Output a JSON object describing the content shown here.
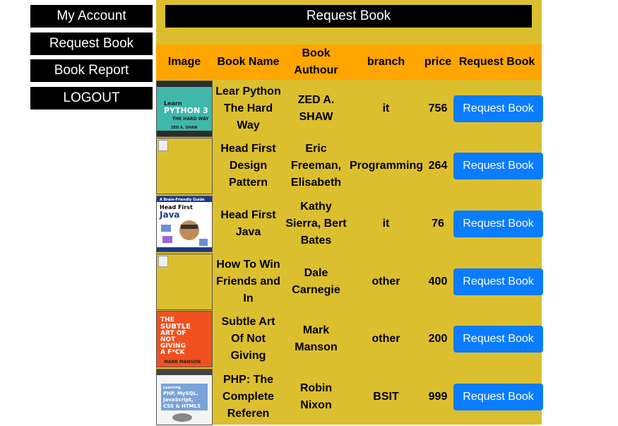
{
  "sidebar": {
    "items": [
      {
        "label": "My Account"
      },
      {
        "label": "Request Book"
      },
      {
        "label": "Book Report"
      },
      {
        "label": "LOGOUT"
      }
    ]
  },
  "page": {
    "title": "Request Book"
  },
  "table": {
    "headers": [
      "Image",
      "Book Name",
      "Book Authour",
      "branch",
      "price",
      "Request Book"
    ],
    "rows": [
      {
        "name": "Lear Python The Hard Way",
        "author": "ZED A. SHAW",
        "branch": "it",
        "price": "756",
        "action": "Request Book"
      },
      {
        "name": "Head First Design Pattern",
        "author": "Eric Freeman, Elisabeth",
        "branch": "Programming",
        "price": "264",
        "action": "Request Book"
      },
      {
        "name": "Head First Java",
        "author": "Kathy Sierra, Bert Bates",
        "branch": "it",
        "price": "76",
        "action": "Request Book"
      },
      {
        "name": "How To Win Friends and In",
        "author": "Dale Carnegie",
        "branch": "other",
        "price": "400",
        "action": "Request Book"
      },
      {
        "name": "Subtle Art Of Not Giving",
        "author": "Mark Manson",
        "branch": "other",
        "price": "200",
        "action": "Request Book"
      },
      {
        "name": "PHP: The Complete Referen",
        "author": "Robin Nixon",
        "branch": "BSIT",
        "price": "999",
        "action": "Request Book"
      }
    ]
  },
  "covers": {
    "python": {
      "line1": "Learn",
      "line2": "PYTHON 3",
      "line3": "THE HARD WAY",
      "author": "ZED A. SHAW"
    },
    "java": {
      "top": "A Brain-Friendly Guide",
      "line1": "Head First",
      "line2": "Java"
    },
    "subtle": {
      "line1": "THE",
      "line2": "SUBTLE",
      "line3": "ART OF",
      "line4": "NOT",
      "line5": "GIVING",
      "line6": "A F*CK",
      "author": "MARK MANSON"
    },
    "php": {
      "line1": "Learning",
      "line2": "PHP, MySQL,",
      "line3": "JavaScript,",
      "line4": "CSS & HTML5"
    }
  },
  "colors": {
    "main_bg": "#dcbf2e",
    "header_bg": "#ffa500",
    "button_blue": "#0a7cff",
    "nav_bg": "#000000"
  }
}
